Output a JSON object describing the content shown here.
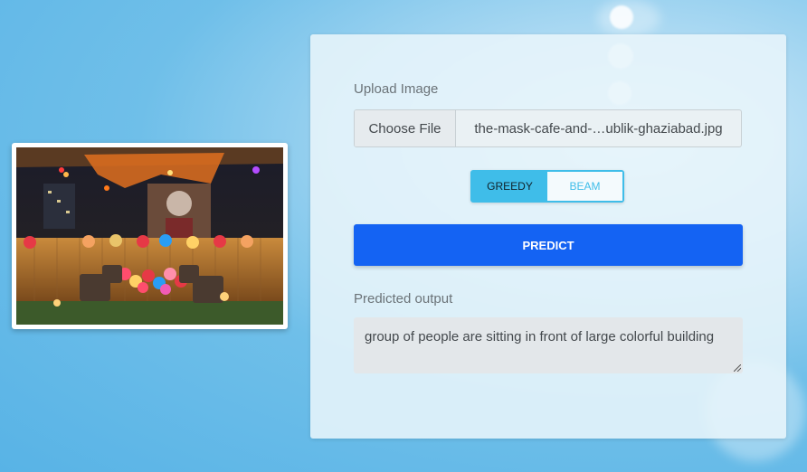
{
  "upload": {
    "label": "Upload Image",
    "button_label": "Choose File",
    "file_name": "the-mask-cafe-and-…ublik-ghaziabad.jpg"
  },
  "decoding": {
    "options": [
      "GREEDY",
      "BEAM"
    ],
    "selected": "GREEDY"
  },
  "predict_label": "PREDICT",
  "output": {
    "label": "Predicted output",
    "text": "group of people are sitting in front of large colorful building"
  },
  "preview": {
    "icon": "uploaded-image-preview"
  },
  "colors": {
    "accent": "#3fbde9",
    "primary": "#1463f3"
  }
}
